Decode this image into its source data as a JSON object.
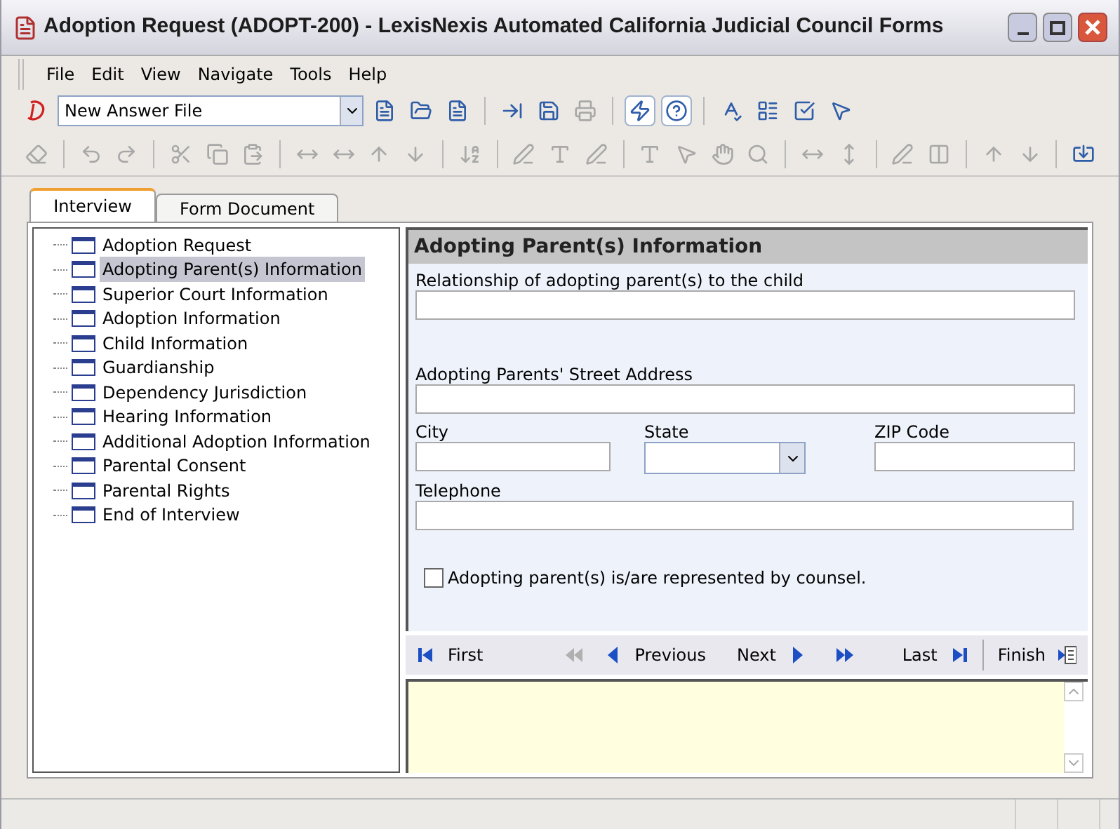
{
  "window": {
    "title": "Adoption Request (ADOPT-200) - LexisNexis Automated California Judicial Council Forms"
  },
  "menu": [
    "File",
    "Edit",
    "View",
    "Navigate",
    "Tools",
    "Help"
  ],
  "answer_file": {
    "value": "New Answer File"
  },
  "tabs": [
    {
      "label": "Interview",
      "selected": true
    },
    {
      "label": "Form Document",
      "selected": false
    }
  ],
  "outline": [
    {
      "label": "Adoption Request",
      "selected": false
    },
    {
      "label": "Adopting Parent(s) Information",
      "selected": true
    },
    {
      "label": "Superior Court Information",
      "selected": false
    },
    {
      "label": "Adoption Information",
      "selected": false
    },
    {
      "label": "Child Information",
      "selected": false
    },
    {
      "label": "Guardianship",
      "selected": false
    },
    {
      "label": "Dependency Jurisdiction",
      "selected": false
    },
    {
      "label": "Hearing Information",
      "selected": false
    },
    {
      "label": "Additional Adoption Information",
      "selected": false
    },
    {
      "label": "Parental Consent",
      "selected": false
    },
    {
      "label": "Parental Rights",
      "selected": false
    },
    {
      "label": "End of Interview",
      "selected": false
    }
  ],
  "dialog": {
    "title": "Adopting Parent(s) Information",
    "relationship": {
      "label": "Relationship of adopting parent(s) to the child"
    },
    "street": {
      "label": "Adopting Parents' Street Address"
    },
    "city": {
      "label": "City"
    },
    "state": {
      "label": "State"
    },
    "zip": {
      "label": "ZIP Code"
    },
    "telephone": {
      "label": "Telephone"
    },
    "counsel": {
      "label": "Adopting parent(s) is/are represented by counsel.",
      "checked": false
    }
  },
  "navigation": [
    {
      "kind": "first",
      "label": "First",
      "disabled": false
    },
    {
      "kind": "back-group",
      "disabled": true
    },
    {
      "kind": "previous",
      "label": "Previous",
      "disabled": false
    },
    {
      "kind": "next",
      "label": "Next",
      "disabled": false
    },
    {
      "kind": "forward-group",
      "disabled": false
    },
    {
      "kind": "last",
      "label": "Last",
      "disabled": false
    },
    {
      "kind": "finish",
      "label": "Finish",
      "disabled": false
    }
  ]
}
